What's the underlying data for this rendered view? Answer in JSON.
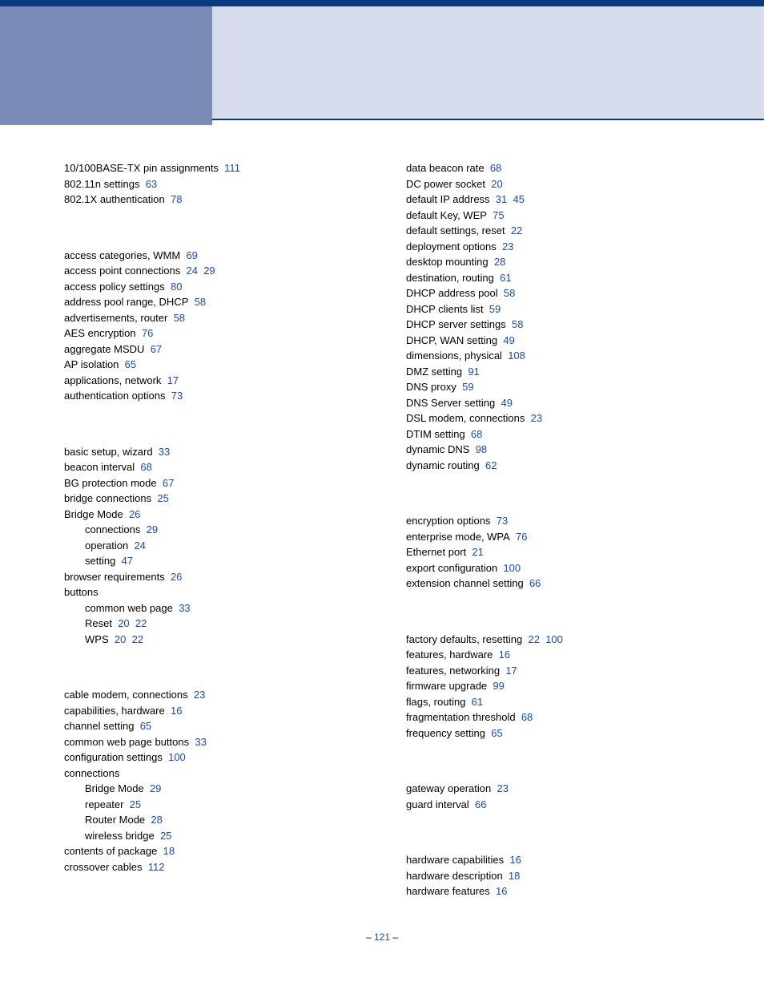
{
  "page_number": "121",
  "left": [
    {
      "t": "10/100BASE-TX pin assignments",
      "p": [
        "111"
      ]
    },
    {
      "t": "802.11n settings",
      "p": [
        "63"
      ]
    },
    {
      "t": "802.1X authentication",
      "p": [
        "78"
      ]
    },
    {
      "gap": true
    },
    {
      "t": "access categories, WMM",
      "p": [
        "69"
      ]
    },
    {
      "t": "access point connections",
      "p": [
        "24",
        "29"
      ]
    },
    {
      "t": "access policy settings",
      "p": [
        "80"
      ]
    },
    {
      "t": "address pool range, DHCP",
      "p": [
        "58"
      ]
    },
    {
      "t": "advertisements, router",
      "p": [
        "58"
      ]
    },
    {
      "t": "AES encryption",
      "p": [
        "76"
      ]
    },
    {
      "t": "aggregate MSDU",
      "p": [
        "67"
      ]
    },
    {
      "t": "AP isolation",
      "p": [
        "65"
      ]
    },
    {
      "t": "applications, network",
      "p": [
        "17"
      ]
    },
    {
      "t": "authentication options",
      "p": [
        "73"
      ]
    },
    {
      "gap": true
    },
    {
      "t": "basic setup, wizard",
      "p": [
        "33"
      ]
    },
    {
      "t": "beacon interval",
      "p": [
        "68"
      ]
    },
    {
      "t": "BG protection mode",
      "p": [
        "67"
      ]
    },
    {
      "t": "bridge connections",
      "p": [
        "25"
      ]
    },
    {
      "t": "Bridge Mode",
      "p": [
        "26"
      ]
    },
    {
      "t": "connections",
      "p": [
        "29"
      ],
      "sub": true
    },
    {
      "t": "operation",
      "p": [
        "24"
      ],
      "sub": true
    },
    {
      "t": "setting",
      "p": [
        "47"
      ],
      "sub": true
    },
    {
      "t": "browser requirements",
      "p": [
        "26"
      ]
    },
    {
      "t": "buttons",
      "p": []
    },
    {
      "t": "common web page",
      "p": [
        "33"
      ],
      "sub": true
    },
    {
      "t": "Reset",
      "p": [
        "20",
        "22"
      ],
      "sub": true
    },
    {
      "t": "WPS",
      "p": [
        "20",
        "22"
      ],
      "sub": true
    },
    {
      "gap": true
    },
    {
      "t": "cable modem, connections",
      "p": [
        "23"
      ]
    },
    {
      "t": "capabilities, hardware",
      "p": [
        "16"
      ]
    },
    {
      "t": "channel setting",
      "p": [
        "65"
      ]
    },
    {
      "t": "common web page buttons",
      "p": [
        "33"
      ]
    },
    {
      "t": "configuration settings",
      "p": [
        "100"
      ]
    },
    {
      "t": "connections",
      "p": []
    },
    {
      "t": "Bridge Mode",
      "p": [
        "29"
      ],
      "sub": true
    },
    {
      "t": "repeater",
      "p": [
        "25"
      ],
      "sub": true
    },
    {
      "t": "Router Mode",
      "p": [
        "28"
      ],
      "sub": true
    },
    {
      "t": "wireless bridge",
      "p": [
        "25"
      ],
      "sub": true
    },
    {
      "t": "contents of package",
      "p": [
        "18"
      ]
    },
    {
      "t": "crossover cables",
      "p": [
        "112"
      ]
    }
  ],
  "right": [
    {
      "t": "data beacon rate",
      "p": [
        "68"
      ]
    },
    {
      "t": "DC power socket",
      "p": [
        "20"
      ]
    },
    {
      "t": "default IP address",
      "p": [
        "31",
        "45"
      ]
    },
    {
      "t": "default Key, WEP",
      "p": [
        "75"
      ]
    },
    {
      "t": "default settings, reset",
      "p": [
        "22"
      ]
    },
    {
      "t": "deployment options",
      "p": [
        "23"
      ]
    },
    {
      "t": "desktop mounting",
      "p": [
        "28"
      ]
    },
    {
      "t": "destination, routing",
      "p": [
        "61"
      ]
    },
    {
      "t": "DHCP address pool",
      "p": [
        "58"
      ]
    },
    {
      "t": "DHCP clients list",
      "p": [
        "59"
      ]
    },
    {
      "t": "DHCP server settings",
      "p": [
        "58"
      ]
    },
    {
      "t": "DHCP, WAN setting",
      "p": [
        "49"
      ]
    },
    {
      "t": "dimensions, physical",
      "p": [
        "108"
      ]
    },
    {
      "t": "DMZ setting",
      "p": [
        "91"
      ]
    },
    {
      "t": "DNS proxy",
      "p": [
        "59"
      ]
    },
    {
      "t": "DNS Server setting",
      "p": [
        "49"
      ]
    },
    {
      "t": "DSL modem, connections",
      "p": [
        "23"
      ]
    },
    {
      "t": "DTIM setting",
      "p": [
        "68"
      ]
    },
    {
      "t": "dynamic DNS",
      "p": [
        "98"
      ]
    },
    {
      "t": "dynamic routing",
      "p": [
        "62"
      ]
    },
    {
      "gap": true
    },
    {
      "t": "encryption options",
      "p": [
        "73"
      ]
    },
    {
      "t": "enterprise mode, WPA",
      "p": [
        "76"
      ]
    },
    {
      "t": "Ethernet port",
      "p": [
        "21"
      ]
    },
    {
      "t": "export configuration",
      "p": [
        "100"
      ]
    },
    {
      "t": "extension channel setting",
      "p": [
        "66"
      ]
    },
    {
      "gap": true
    },
    {
      "t": "factory defaults, resetting",
      "p": [
        "22",
        "100"
      ]
    },
    {
      "t": "features, hardware",
      "p": [
        "16"
      ]
    },
    {
      "t": "features, networking",
      "p": [
        "17"
      ]
    },
    {
      "t": "firmware upgrade",
      "p": [
        "99"
      ]
    },
    {
      "t": "flags, routing",
      "p": [
        "61"
      ]
    },
    {
      "t": "fragmentation threshold",
      "p": [
        "68"
      ]
    },
    {
      "t": "frequency setting",
      "p": [
        "65"
      ]
    },
    {
      "gap": true
    },
    {
      "t": "gateway operation",
      "p": [
        "23"
      ]
    },
    {
      "t": "guard interval",
      "p": [
        "66"
      ]
    },
    {
      "gap": true
    },
    {
      "t": "hardware capabilities",
      "p": [
        "16"
      ]
    },
    {
      "t": "hardware description",
      "p": [
        "18"
      ]
    },
    {
      "t": "hardware features",
      "p": [
        "16"
      ]
    }
  ]
}
